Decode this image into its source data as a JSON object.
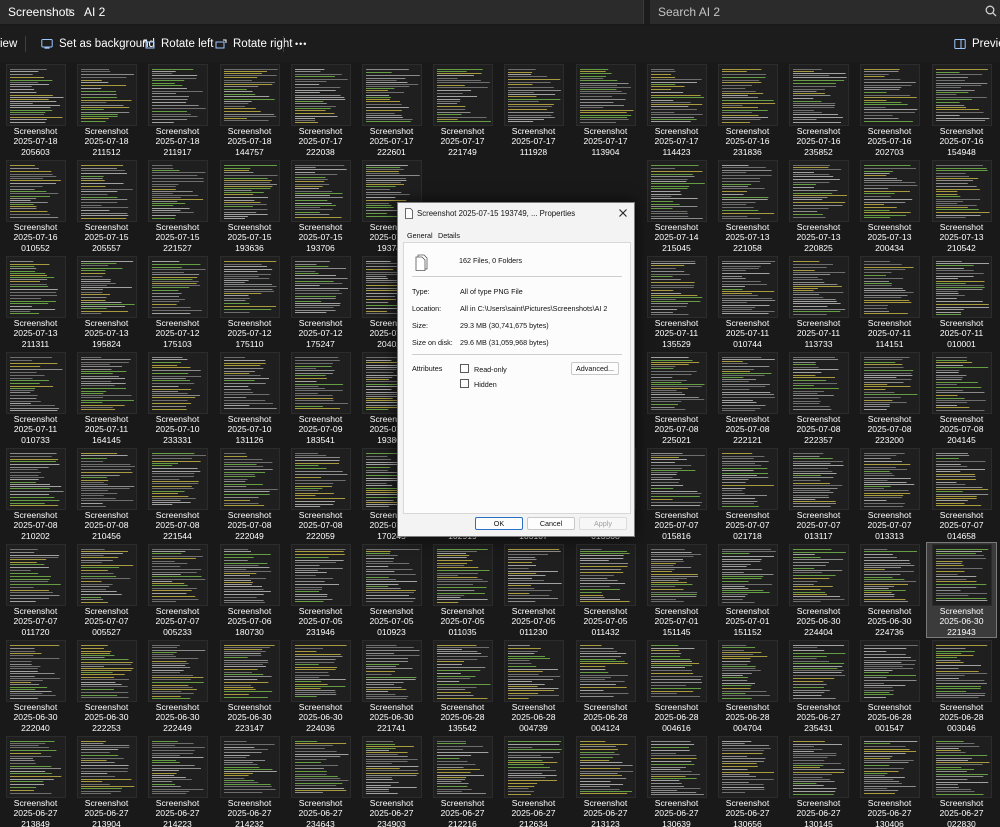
{
  "address_bar": {
    "breadcrumb": [
      "Screenshots",
      "AI 2"
    ],
    "search_placeholder": "Search AI 2"
  },
  "command_bar": {
    "view_label": "iew",
    "set_background_label": "Set as background",
    "rotate_left_label": "Rotate left",
    "rotate_right_label": "Rotate right",
    "more_label": "•••",
    "preview_label": "Preview"
  },
  "files": {
    "label": "Screenshot",
    "rows": [
      [
        [
          "2025-07-18",
          "205603"
        ],
        [
          "2025-07-18",
          "211512"
        ],
        [
          "2025-07-18",
          "211917"
        ],
        [
          "2025-07-18",
          "144757"
        ],
        [
          "2025-07-17",
          "222038"
        ],
        [
          "2025-07-17",
          "222601"
        ],
        [
          "2025-07-17",
          "221749"
        ],
        [
          "2025-07-17",
          "111928"
        ],
        [
          "2025-07-17",
          "113904"
        ],
        [
          "2025-07-17",
          "114423"
        ],
        [
          "2025-07-16",
          "231836"
        ],
        [
          "2025-07-16",
          "235852"
        ],
        [
          "2025-07-16",
          "202703"
        ],
        [
          "2025-07-16",
          "154948"
        ]
      ],
      [
        [
          "2025-07-16",
          "010552"
        ],
        [
          "2025-07-15",
          "205557"
        ],
        [
          "2025-07-15",
          "221527"
        ],
        [
          "2025-07-15",
          "193636"
        ],
        [
          "2025-07-15",
          "193706"
        ],
        [
          "2025-07-15",
          "193749"
        ],
        [
          "",
          ""
        ],
        [
          "",
          ""
        ],
        [
          "",
          ""
        ],
        [
          "2025-07-14",
          "215045"
        ],
        [
          "2025-07-13",
          "221058"
        ],
        [
          "2025-07-13",
          "220825"
        ],
        [
          "2025-07-13",
          "200434"
        ],
        [
          "2025-07-13",
          "210542"
        ]
      ],
      [
        [
          "2025-07-13",
          "211311"
        ],
        [
          "2025-07-13",
          "195824"
        ],
        [
          "2025-07-12",
          "175103"
        ],
        [
          "2025-07-12",
          "175110"
        ],
        [
          "2025-07-12",
          "175247"
        ],
        [
          "2025-07-12",
          "204021"
        ],
        [
          "",
          ""
        ],
        [
          "",
          ""
        ],
        [
          "",
          ""
        ],
        [
          "2025-07-11",
          "135529"
        ],
        [
          "2025-07-11",
          "010744"
        ],
        [
          "2025-07-11",
          "113733"
        ],
        [
          "2025-07-11",
          "114151"
        ],
        [
          "2025-07-11",
          "010001"
        ]
      ],
      [
        [
          "2025-07-11",
          "010733"
        ],
        [
          "2025-07-11",
          "164145"
        ],
        [
          "2025-07-10",
          "233331"
        ],
        [
          "2025-07-10",
          "131126"
        ],
        [
          "2025-07-09",
          "183541"
        ],
        [
          "2025-07-09",
          "193801"
        ],
        [
          "",
          ""
        ],
        [
          "",
          ""
        ],
        [
          "",
          ""
        ],
        [
          "2025-07-08",
          "225021"
        ],
        [
          "2025-07-08",
          "222121"
        ],
        [
          "2025-07-08",
          "222357"
        ],
        [
          "2025-07-08",
          "223200"
        ],
        [
          "2025-07-08",
          "204145"
        ]
      ],
      [
        [
          "2025-07-08",
          "210202"
        ],
        [
          "2025-07-08",
          "210456"
        ],
        [
          "2025-07-08",
          "221544"
        ],
        [
          "2025-07-08",
          "222049"
        ],
        [
          "2025-07-08",
          "222059"
        ],
        [
          "2025-07-08",
          "170245"
        ],
        [
          "2025-07-07",
          "102919"
        ],
        [
          "2025-07-07",
          "103107"
        ],
        [
          "2025-07-07",
          "013508"
        ],
        [
          "2025-07-07",
          "015816"
        ],
        [
          "2025-07-07",
          "021718"
        ],
        [
          "2025-07-07",
          "013117"
        ],
        [
          "2025-07-07",
          "013313"
        ],
        [
          "2025-07-07",
          "014658"
        ]
      ],
      [
        [
          "2025-07-07",
          "011720"
        ],
        [
          "2025-07-07",
          "005527"
        ],
        [
          "2025-07-07",
          "005233"
        ],
        [
          "2025-07-06",
          "180730"
        ],
        [
          "2025-07-05",
          "231946"
        ],
        [
          "2025-07-05",
          "010923"
        ],
        [
          "2025-07-05",
          "011035"
        ],
        [
          "2025-07-05",
          "011230"
        ],
        [
          "2025-07-05",
          "011432"
        ],
        [
          "2025-07-01",
          "151145"
        ],
        [
          "2025-07-01",
          "151152"
        ],
        [
          "2025-06-30",
          "224404"
        ],
        [
          "2025-06-30",
          "224736"
        ],
        [
          "2025-06-30",
          "221943"
        ]
      ],
      [
        [
          "2025-06-30",
          "222040"
        ],
        [
          "2025-06-30",
          "222253"
        ],
        [
          "2025-06-30",
          "222449"
        ],
        [
          "2025-06-30",
          "223147"
        ],
        [
          "2025-06-30",
          "224036"
        ],
        [
          "2025-06-30",
          "221741"
        ],
        [
          "2025-06-28",
          "135542"
        ],
        [
          "2025-06-28",
          "004739"
        ],
        [
          "2025-06-28",
          "004124"
        ],
        [
          "2025-06-28",
          "004616"
        ],
        [
          "2025-06-28",
          "004704"
        ],
        [
          "2025-06-27",
          "235431"
        ],
        [
          "2025-06-28",
          "001547"
        ],
        [
          "2025-06-28",
          "003046"
        ]
      ],
      [
        [
          "2025-06-27",
          "213849"
        ],
        [
          "2025-06-27",
          "213904"
        ],
        [
          "2025-06-27",
          "214223"
        ],
        [
          "2025-06-27",
          "214232"
        ],
        [
          "2025-06-27",
          "234643"
        ],
        [
          "2025-06-27",
          "234903"
        ],
        [
          "2025-06-27",
          "212216"
        ],
        [
          "2025-06-27",
          "212634"
        ],
        [
          "2025-06-27",
          "213123"
        ],
        [
          "2025-06-27",
          "130639"
        ],
        [
          "2025-06-27",
          "130656"
        ],
        [
          "2025-06-27",
          "130145"
        ],
        [
          "2025-06-27",
          "130406"
        ],
        [
          "2025-06-27",
          "022830"
        ]
      ]
    ]
  },
  "properties_dialog": {
    "title": "Screenshot 2025-07-15 193749, ... Properties",
    "tabs": [
      "General",
      "Details"
    ],
    "summary": "162 Files, 0 Folders",
    "fields": [
      {
        "label": "Type:",
        "value": "All of type PNG File"
      },
      {
        "label": "Location:",
        "value": "All in C:\\Users\\saint\\Pictures\\Screenshots\\AI 2"
      },
      {
        "label": "Size:",
        "value": "29.3 MB (30,741,675 bytes)"
      },
      {
        "label": "Size on disk:",
        "value": "29.6 MB (31,059,968 bytes)"
      }
    ],
    "attributes_label": "Attributes",
    "readonly_label": "Read-only",
    "hidden_label": "Hidden",
    "advanced_label": "Advanced...",
    "ok_label": "OK",
    "cancel_label": "Cancel",
    "apply_label": "Apply"
  },
  "colors": {
    "background": "#191919",
    "selected_tile": "#3b3b3b",
    "dialog_background": "#f3f3f3",
    "ok_border": "#2a6fc8",
    "text_highlight_green": "#7ec850",
    "text_highlight_yellow": "#d8c44a"
  }
}
